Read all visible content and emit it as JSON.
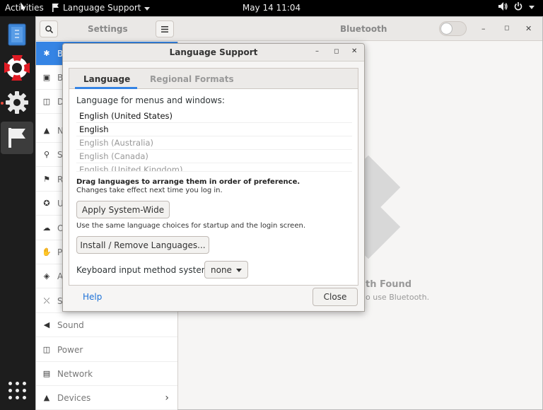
{
  "topbar": {
    "activities": "Activities",
    "app_menu": "Language Support",
    "clock": "May 14  11:04"
  },
  "settings": {
    "title": "Settings",
    "panel_title": "Bluetooth",
    "sidebar": [
      {
        "initial": "B",
        "icon": "bluetooth-icon",
        "selected": true
      },
      {
        "initial": "B",
        "icon": "background-icon"
      },
      {
        "initial": "D",
        "icon": "display-icon"
      },
      {
        "initial": "N",
        "icon": "bell-icon"
      },
      {
        "initial": "S",
        "icon": "search-icon"
      },
      {
        "initial": "R",
        "icon": "flag-icon"
      },
      {
        "initial": "U",
        "icon": "accessibility-icon"
      },
      {
        "initial": "O",
        "icon": "cloud-icon"
      },
      {
        "initial": "P",
        "icon": "hand-icon"
      },
      {
        "initial": "A",
        "icon": "diamond-icon"
      },
      {
        "initial": "S",
        "icon": "share-icon"
      },
      {
        "label": "Sound",
        "icon": "speaker-icon"
      },
      {
        "label": "Power",
        "icon": "power-icon"
      },
      {
        "label": "Network",
        "icon": "network-icon"
      },
      {
        "label": "Devices",
        "icon": "devices-icon",
        "chevron": true
      }
    ],
    "empty_title": "th Found",
    "empty_sub": "o use Bluetooth."
  },
  "dialog": {
    "title": "Language Support",
    "tabs": [
      "Language",
      "Regional Formats"
    ],
    "menu_label": "Language for menus and windows:",
    "languages": [
      {
        "name": "English (United States)",
        "enabled": true
      },
      {
        "name": "English",
        "enabled": true
      },
      {
        "name": "English (Australia)",
        "enabled": false
      },
      {
        "name": "English (Canada)",
        "enabled": false
      },
      {
        "name": "English (United Kingdom)",
        "enabled": false
      }
    ],
    "drag_hint": "Drag languages to arrange them in order of preference.",
    "effect_hint": "Changes take effect next time you log in.",
    "apply_button": "Apply System-Wide",
    "apply_hint": "Use the same language choices for startup and the login screen.",
    "install_button": "Install / Remove Languages...",
    "keyboard_label": "Keyboard input method system:",
    "keyboard_value": "none",
    "help": "Help",
    "close": "Close"
  },
  "colors": {
    "accent": "#3584e4",
    "link": "#1c71d8"
  }
}
